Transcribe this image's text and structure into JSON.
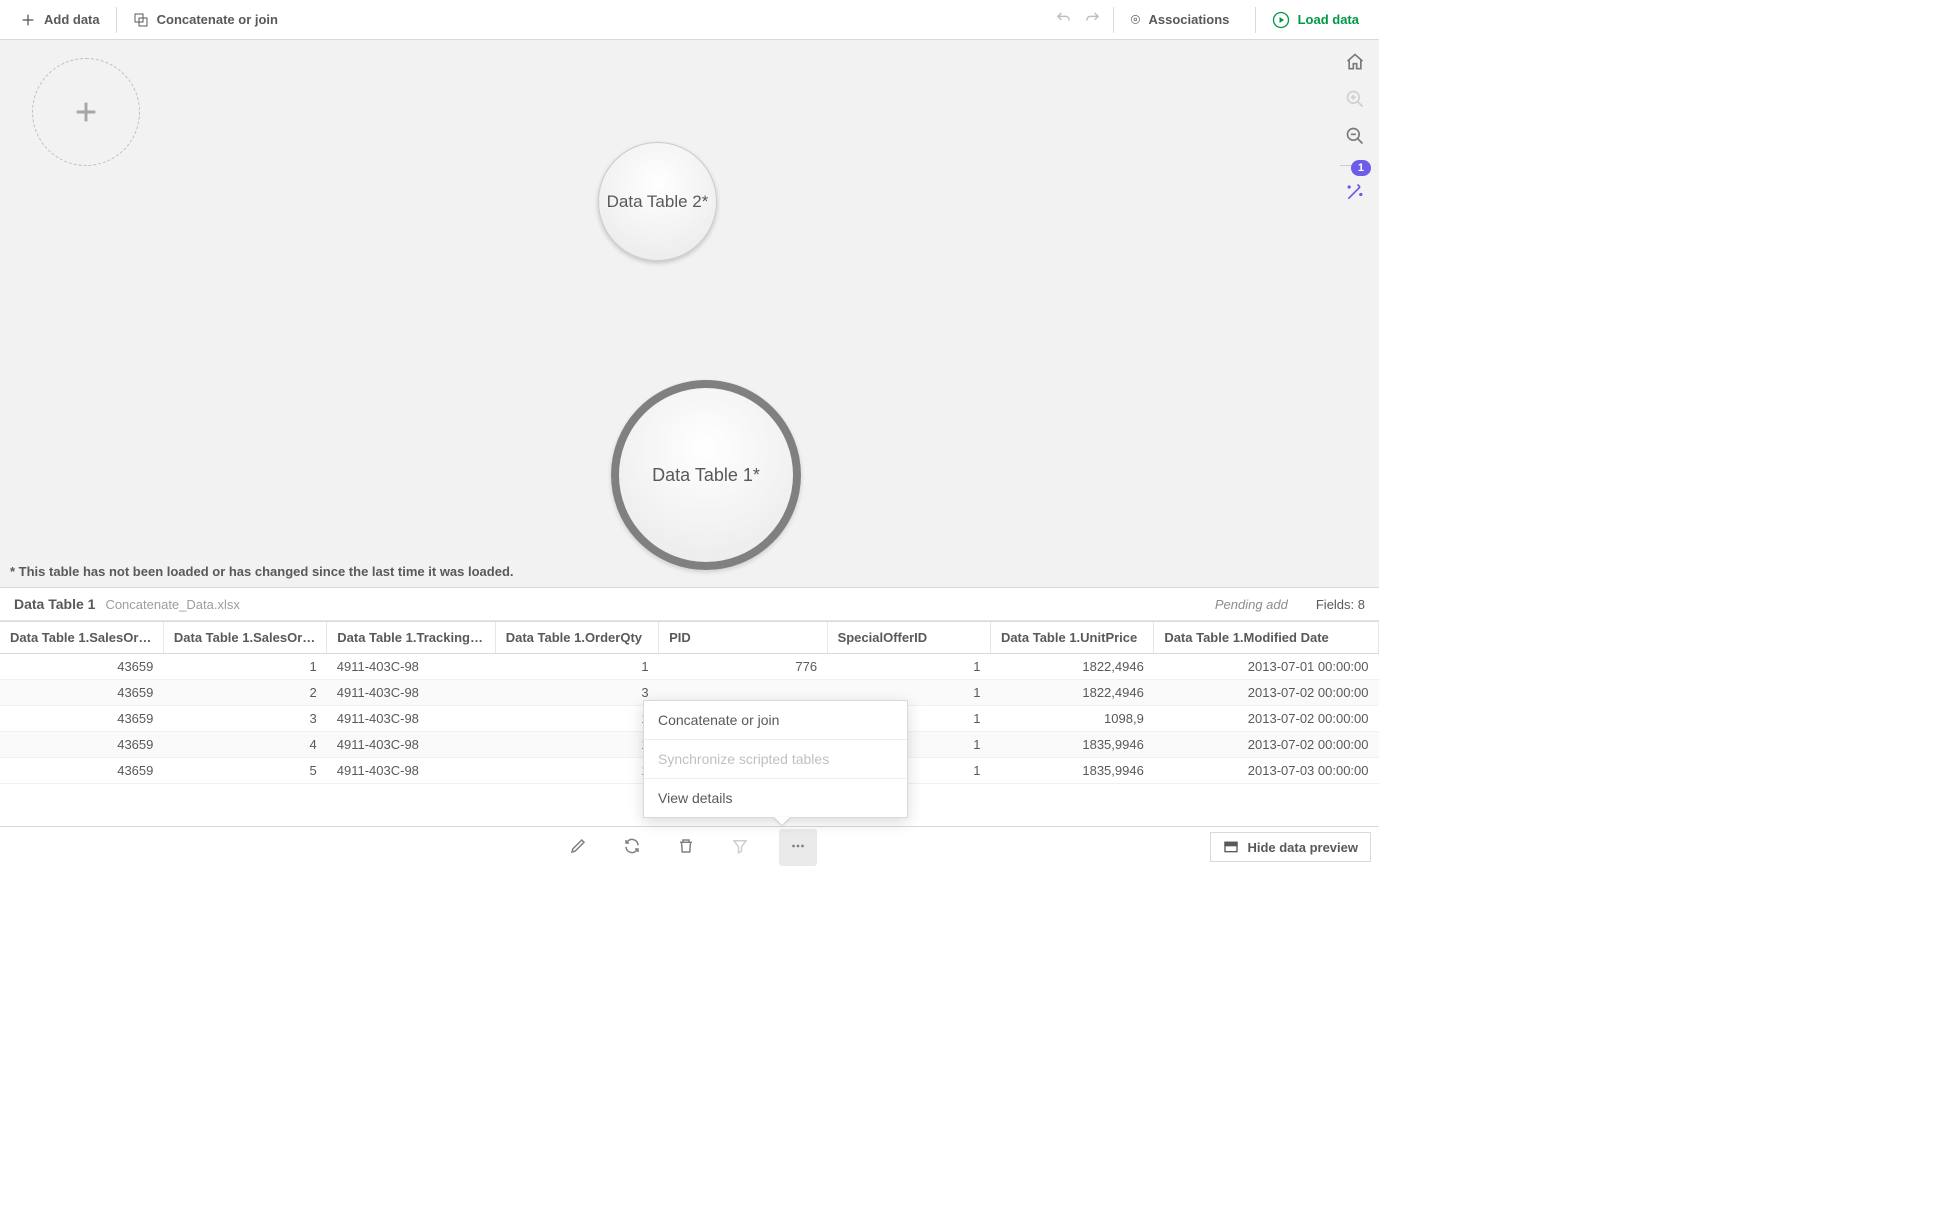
{
  "toolbar": {
    "add_data": "Add data",
    "concat_join": "Concatenate or join",
    "associations": "Associations",
    "load_data": "Load data"
  },
  "bubbles": {
    "table1": "Data Table 1*",
    "table2": "Data Table 2*"
  },
  "footnote": "* This table has not been loaded or has changed since the last time it was loaded.",
  "rightrail": {
    "badge": "1"
  },
  "preview": {
    "table_name": "Data Table 1",
    "file_name": "Concatenate_Data.xlsx",
    "pending": "Pending add",
    "fields_label": "Fields: 8",
    "columns": [
      "Data Table 1.SalesOr…",
      "Data Table 1.SalesOr…",
      "Data Table 1.Tracking…",
      "Data Table 1.OrderQty",
      "PID",
      "SpecialOfferID",
      "Data Table 1.UnitPrice",
      "Data Table 1.Modified Date"
    ],
    "rows": [
      [
        "43659",
        "1",
        "4911-403C-98",
        "1",
        "776",
        "1",
        "1822,4946",
        "2013-07-01 00:00:00"
      ],
      [
        "43659",
        "2",
        "4911-403C-98",
        "3",
        "",
        "1",
        "1822,4946",
        "2013-07-02 00:00:00"
      ],
      [
        "43659",
        "3",
        "4911-403C-98",
        "1",
        "",
        "1",
        "1098,9",
        "2013-07-02 00:00:00"
      ],
      [
        "43659",
        "4",
        "4911-403C-98",
        "1",
        "",
        "1",
        "1835,9946",
        "2013-07-02 00:00:00"
      ],
      [
        "43659",
        "5",
        "4911-403C-98",
        "1",
        "",
        "1",
        "1835,9946",
        "2013-07-03 00:00:00"
      ]
    ]
  },
  "context_menu": {
    "concat": "Concatenate or join",
    "sync": "Synchronize scripted tables",
    "details": "View details"
  },
  "bottom": {
    "hide_preview": "Hide data preview"
  }
}
